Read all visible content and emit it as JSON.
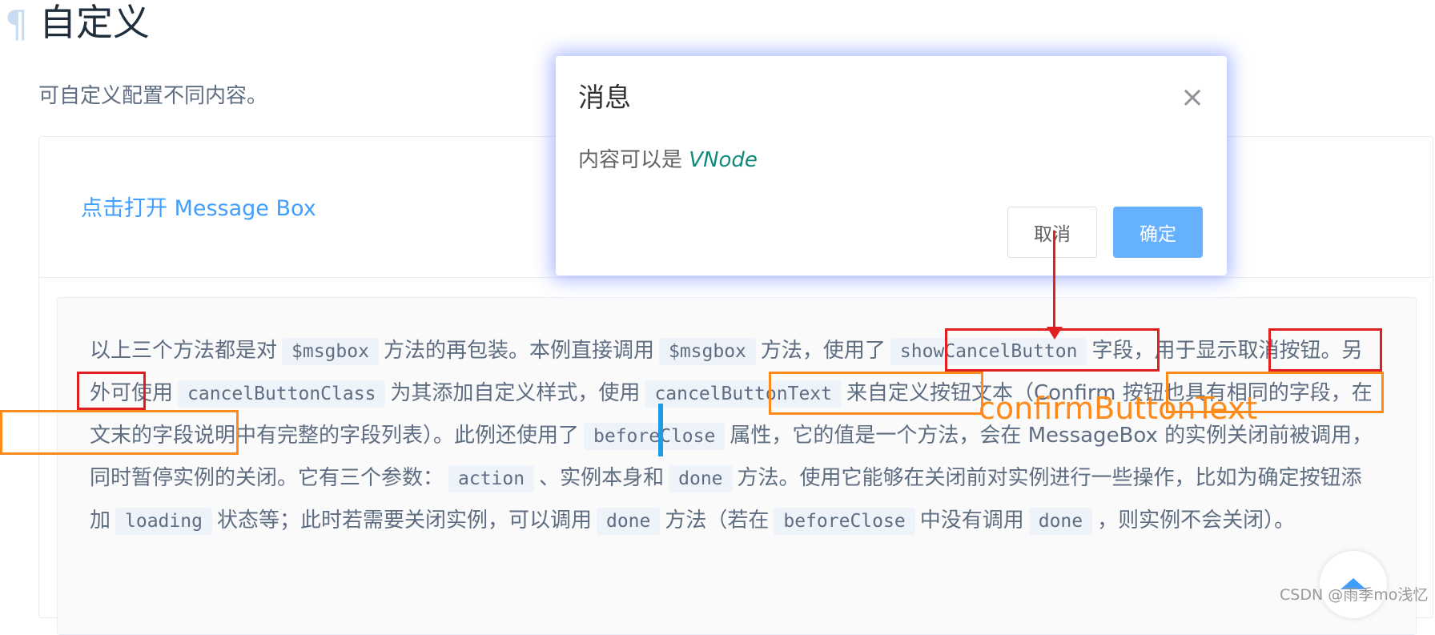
{
  "page": {
    "pilcrow": "¶",
    "title": "自定义",
    "subtitle": "可自定义配置不同内容。",
    "open_button": "点击打开 Message Box",
    "description": {
      "p1": "以上三个方法都是对",
      "c1": "$msgbox",
      "p2": "方法的再包装。本例直接调用",
      "c2": "$msgbox",
      "p3": "方法，使用了",
      "c3": "showCancelButton",
      "p4": "字段，用于显示取消按钮。另外可使用",
      "c4": "cancelButtonClass",
      "p5": "为其添加自定义样式，使用",
      "c5": "cancelButtonText",
      "p6": "来自定义按钮文本（Confirm 按钮也具有相同的字段，在文末的字段说明中有完整的字段列表）。此例还使用了",
      "c6": "beforeClose",
      "p7": "属性，它的值是一个方法，会在 MessageBox 的实例关闭前被调用，同时暂停实例的关闭。它有三个参数：",
      "c7": "action",
      "p8": "、实例本身和",
      "c8": "done",
      "p9": "方法。使用它能够在关闭前对实例进行一些操作，比如为确定按钮添加",
      "c9": "loading",
      "p10": "状态等；此时若需要关闭实例，可以调用",
      "c10": "done",
      "p11": "方法（若在",
      "c11": "beforeClose",
      "p12": "中没有调用",
      "c12": "done",
      "p13": "，则实例不会关闭）。"
    }
  },
  "dialog": {
    "title": "消息",
    "close_icon": "×",
    "content_prefix": "内容可以是",
    "content_vnode": "VNode",
    "cancel_label": "取消",
    "confirm_label": "确定"
  },
  "annotations": {
    "confirm_label": "confirmButtonText",
    "red_color": "#e02020",
    "orange_color": "#ff8a1c"
  },
  "watermark": "CSDN @雨季mo浅忆",
  "colors": {
    "link": "#409eff",
    "primary_button": "#66b1ff",
    "code_bg": "#eef3f9"
  }
}
